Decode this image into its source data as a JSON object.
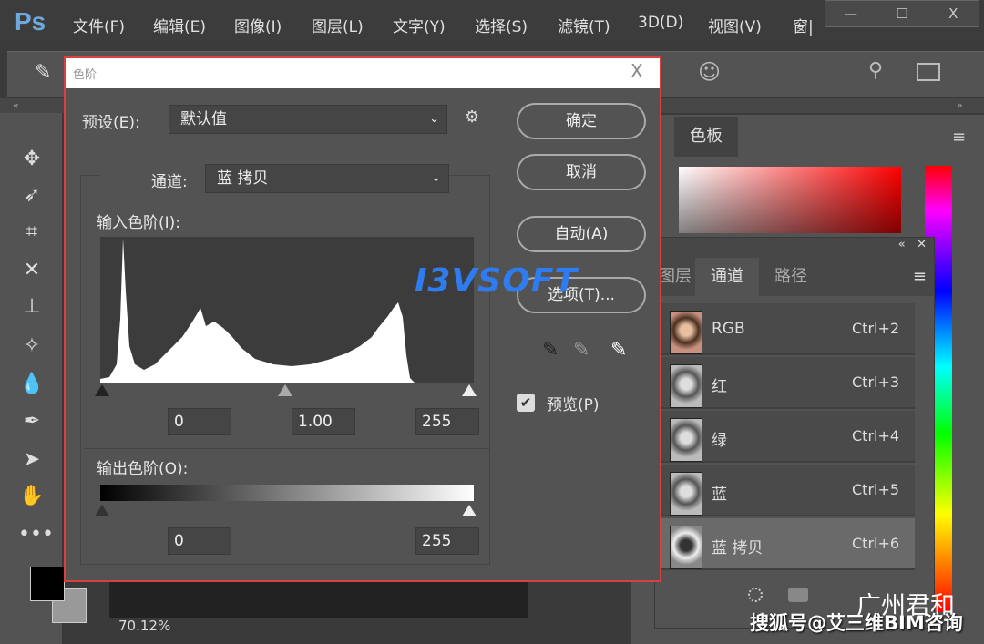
{
  "app": {
    "logo": "Ps",
    "menu": [
      "文件(F)",
      "编辑(E)",
      "图像(I)",
      "图层(L)",
      "文字(Y)",
      "选择(S)",
      "滤镜(T)",
      "3D(D)",
      "视图(V)",
      "窗|"
    ],
    "window_controls": [
      "—",
      "☐",
      "X"
    ]
  },
  "canvas": {
    "zoom": "70.12%"
  },
  "dialog": {
    "title": "色阶",
    "close": "X",
    "preset_label": "预设(E):",
    "preset_value": "默认值",
    "channel_label": "通道:",
    "channel_value": "蓝 拷贝",
    "input_label": "输入色阶(I):",
    "input_black": "0",
    "input_gamma": "1.00",
    "input_white": "255",
    "output_label": "输出色阶(O):",
    "output_black": "0",
    "output_white": "255",
    "buttons": {
      "ok": "确定",
      "cancel": "取消",
      "auto": "自动(A)",
      "options": "选项(T)..."
    },
    "preview_label": "预览(P)",
    "preview_checked": true
  },
  "color_panel": {
    "tab": "色板"
  },
  "channels_panel": {
    "tabs": [
      "图层",
      "通道",
      "路径"
    ],
    "active_tab": "通道",
    "channels": [
      {
        "name": "RGB",
        "shortcut": "Ctrl+2"
      },
      {
        "name": "红",
        "shortcut": "Ctrl+3"
      },
      {
        "name": "绿",
        "shortcut": "Ctrl+4"
      },
      {
        "name": "蓝",
        "shortcut": "Ctrl+5"
      },
      {
        "name": "蓝 拷贝",
        "shortcut": "Ctrl+6",
        "selected": true
      }
    ]
  },
  "watermarks": {
    "logo": "I3VSOFT",
    "line1": "广州君和",
    "line2": "搜狐号@艾三维BIM咨询"
  }
}
